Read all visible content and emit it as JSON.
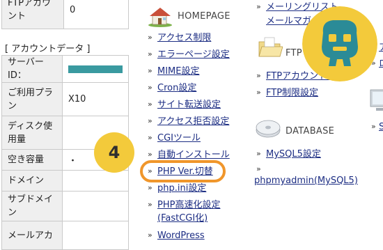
{
  "account": {
    "ftp_label": "FTPアカウント",
    "ftp_value": "0",
    "data_header": "[ アカウントデータ ]",
    "rows": [
      {
        "key": "サーバーID：",
        "value": ""
      },
      {
        "key": "ご利用プラン",
        "value": "X10"
      },
      {
        "key": "ディスク使用量",
        "value": ""
      },
      {
        "key": "空き容量",
        "value": "・"
      },
      {
        "key": "ドメイン",
        "value": ""
      },
      {
        "key": "サブドメイン",
        "value": ""
      },
      {
        "key": "メールアカ",
        "value": ""
      }
    ]
  },
  "homepage": {
    "title": "HOMEPAGE",
    "links": [
      "アクセス制限",
      "エラーページ設定",
      "MIME設定",
      "Cron設定",
      "サイト転送設定",
      "アクセス拒否設定",
      "CGIツール",
      "自動インストール",
      "PHP Ver.切替",
      "php.ini設定",
      "PHP高速化設定",
      "(FastCGI化)",
      "WordPress"
    ]
  },
  "mail": {
    "links": [
      "メーリングリスト",
      "メールマガ"
    ]
  },
  "ftp": {
    "title": "FTP",
    "links": [
      "FTPアカウント設定",
      "FTP制限設定"
    ]
  },
  "database": {
    "title": "DATABASE",
    "links": [
      "MySQL5設定",
      "phpmyadmin(MySQL5)"
    ]
  },
  "right_edge": {
    "links": [
      "ア",
      "ロ",
      "S"
    ]
  },
  "step": "4",
  "colors": {
    "link": "#1c2d83",
    "highlight": "#f0962b",
    "badge": "#f3ca3b",
    "table_key_bg": "#efefef"
  }
}
